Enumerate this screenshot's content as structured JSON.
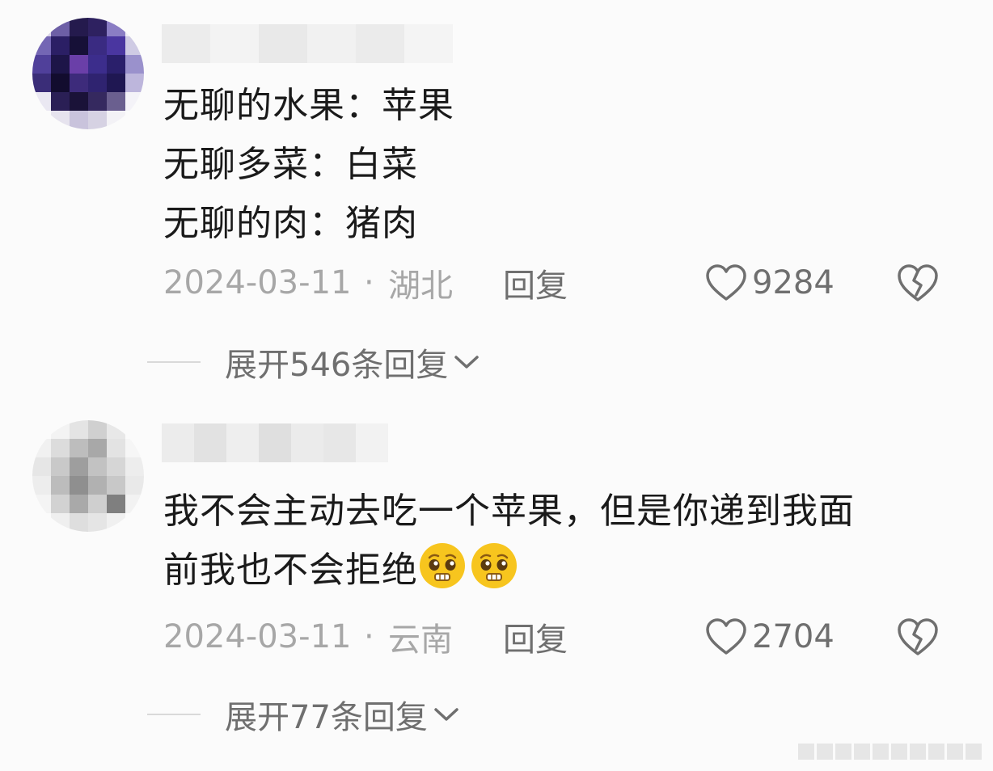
{
  "comments": [
    {
      "text_lines": [
        "无聊的水果：苹果",
        "无聊多菜：白菜",
        "无聊的肉：猪肉"
      ],
      "date": "2024-03-11",
      "separator": "·",
      "location": "湖北",
      "reply_label": "回复",
      "likes": "9284",
      "expand_label": "展开546条回复"
    },
    {
      "text_lines": [
        "我不会主动去吃一个苹果，但是你递到我面",
        "前我也不会拒绝"
      ],
      "emojis": [
        "pleading-face-emoji",
        "pleading-face-emoji"
      ],
      "date": "2024-03-11",
      "separator": "·",
      "location": "云南",
      "reply_label": "回复",
      "likes": "2704",
      "expand_label": "展开77条回复"
    }
  ],
  "icons": {
    "like": "heart-outline-icon",
    "dislike": "broken-heart-icon",
    "expand": "chevron-down-icon"
  },
  "colors": {
    "background": "#fbfbfb",
    "text": "#1a1a1a",
    "meta": "#a7a7a7",
    "action": "#6f6f6f",
    "emoji": "#f7c51e"
  }
}
